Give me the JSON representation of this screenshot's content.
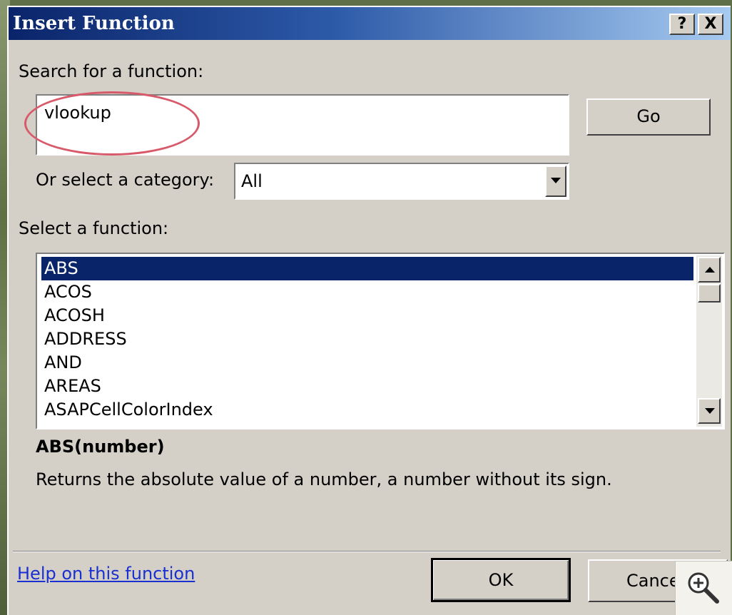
{
  "dialog": {
    "title": "Insert Function",
    "help_btn": "?",
    "close_btn": "X"
  },
  "search": {
    "label": "Search for a function:",
    "value": "vlookup",
    "go_label": "Go"
  },
  "category": {
    "label": "Or select a category:",
    "value": "All"
  },
  "functions": {
    "label": "Select a function:",
    "items": [
      "ABS",
      "ACOS",
      "ACOSH",
      "ADDRESS",
      "AND",
      "AREAS",
      "ASAPCellColorIndex"
    ],
    "selected": "ABS"
  },
  "details": {
    "signature": "ABS(number)",
    "description": "Returns the absolute value of a number, a number without its sign."
  },
  "footer": {
    "help_link": "Help on this function",
    "ok_label": "OK",
    "cancel_label": "Cance"
  },
  "colors": {
    "titlebar_start": "#0a246a",
    "titlebar_end": "#a6caf0",
    "selection": "#0a246a",
    "annotation": "#d85a6a",
    "link": "#1a2fd0"
  },
  "icons": {
    "zoom": "zoom-in-icon",
    "dropdown": "chevron-down-icon",
    "scroll_up": "scroll-up-icon",
    "scroll_down": "scroll-down-icon"
  }
}
